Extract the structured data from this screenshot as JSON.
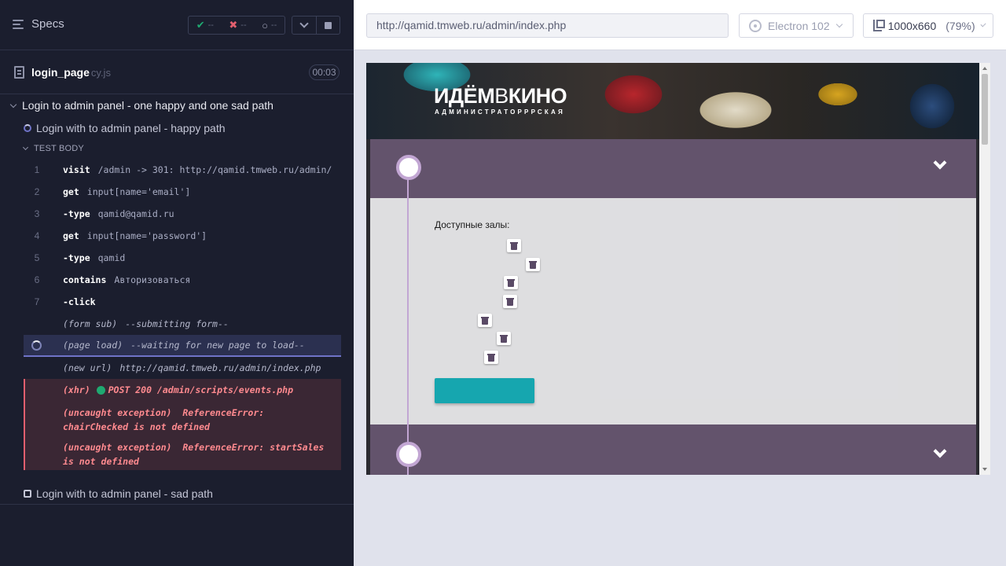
{
  "runner": {
    "specs_label": "Specs",
    "stats": {
      "passed": "--",
      "failed": "--",
      "pending": "--"
    },
    "file": {
      "name": "login_page",
      "ext": "cy.js",
      "duration": "00:03"
    },
    "suite_title": "Login to admin panel - one happy and one sad path",
    "tests": [
      {
        "title": "Login with to admin panel - happy path",
        "state": "running"
      },
      {
        "title": "Login with to admin panel - sad path",
        "state": "pending"
      }
    ],
    "test_body_label": "TEST BODY",
    "commands": [
      {
        "num": "1",
        "name": "visit",
        "message": "/admin -> 301: http://qamid.tmweb.ru/admin/"
      },
      {
        "num": "2",
        "name": "get",
        "message": "input[name='email']"
      },
      {
        "num": "3",
        "name": "-type",
        "message": "qamid@qamid.ru"
      },
      {
        "num": "4",
        "name": "get",
        "message": "input[name='password']"
      },
      {
        "num": "5",
        "name": "-type",
        "message": "qamid"
      },
      {
        "num": "6",
        "name": "contains",
        "message": "Авторизоваться"
      },
      {
        "num": "7",
        "name": "-click",
        "message": ""
      },
      {
        "num": "",
        "name": "(form sub)",
        "message": "--submitting form--"
      },
      {
        "num": "",
        "name": "(page load)",
        "message": "--waiting for new page to load--"
      },
      {
        "num": "",
        "name": "(new url)",
        "message": "http://qamid.tmweb.ru/admin/index.php"
      }
    ],
    "errors": [
      {
        "name": "(xhr)",
        "message": "POST 200 /admin/scripts/events.php"
      },
      {
        "name": "(uncaught exception)",
        "message": "ReferenceError: chairChecked is not defined"
      },
      {
        "name": "(uncaught exception)",
        "message": "ReferenceError: startSales is not defined"
      }
    ]
  },
  "browser": {
    "url": "http://qamid.tmweb.ru/admin/index.php",
    "browser_name": "Electron 102",
    "viewport": "1000x660",
    "zoom": "(79%)"
  },
  "aut": {
    "logo_bold": "ИДЁМ",
    "logo_thin": "В",
    "logo_end": "КИНО",
    "logo_sub": "АДМИНИСТРАТОРРРСКАЯ",
    "halls_label": "Доступные залы:",
    "hall_delete_buttons": 7,
    "colors": {
      "header_purple": "#63536c",
      "accent_teal": "#16a6af",
      "timeline": "#c2a6d3"
    }
  }
}
